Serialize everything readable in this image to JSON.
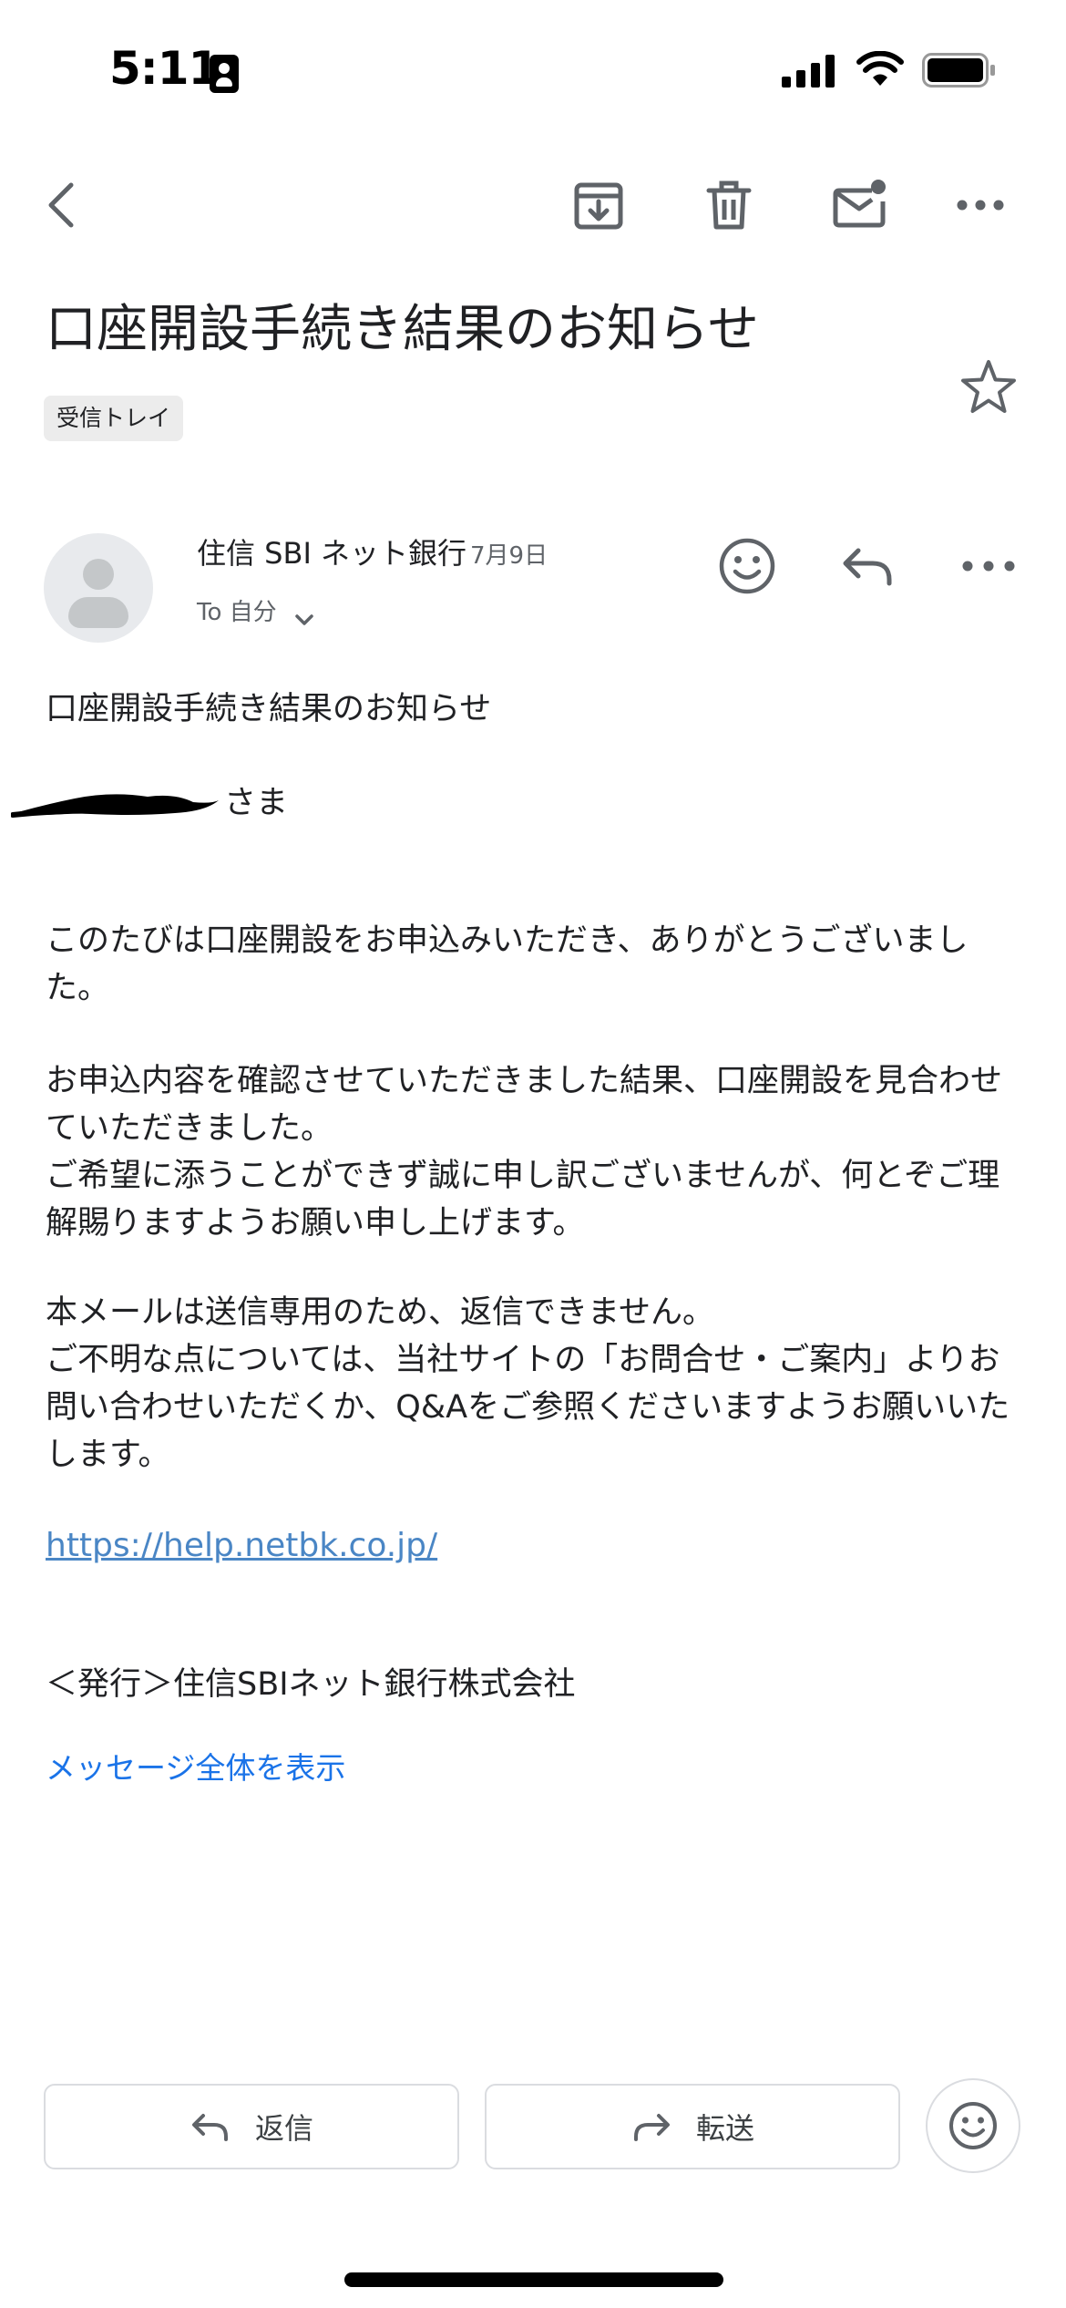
{
  "status_bar": {
    "time": "5:11"
  },
  "toolbar": {
    "icons": [
      "back-arrow-icon",
      "archive-icon",
      "trash-icon",
      "mark-unread-icon",
      "more-icon"
    ]
  },
  "email": {
    "subject": "口座開設手続き結果のお知らせ",
    "label": "受信トレイ",
    "sender": {
      "name": "住信 SBI ネット銀行",
      "date": "7月9日",
      "to": "To 自分"
    },
    "body": {
      "heading": "口座開設手続き結果のお知らせ",
      "greeting_suffix": "さま",
      "paragraph1": "このたびは口座開設をお申込みいただき、ありがとうございました。",
      "paragraph2": "お申込内容を確認させていただきました結果、口座開設を見合わせていただきました。\nご希望に添うことができず誠に申し訳ございませんが、何とぞご理解賜りますようお願い申し上げます。",
      "paragraph3": "本メールは送信専用のため、返信できません。\nご不明な点については、当社サイトの「お問合せ・ご案内」よりお問い合わせいただくか、Q&Aをご参照くださいますようお願いいたします。",
      "link": "https://help.netbk.co.jp/",
      "publisher": "＜発行＞住信SBIネット銀行株式会社"
    },
    "show_full_message": "メッセージ全体を表示"
  },
  "bottom_bar": {
    "reply_label": "返信",
    "forward_label": "転送"
  },
  "colors": {
    "link": "#4a86c5",
    "accent": "#1a73e8",
    "text": "#202124",
    "secondary_text": "#5f6368",
    "icon": "#5f6368"
  }
}
